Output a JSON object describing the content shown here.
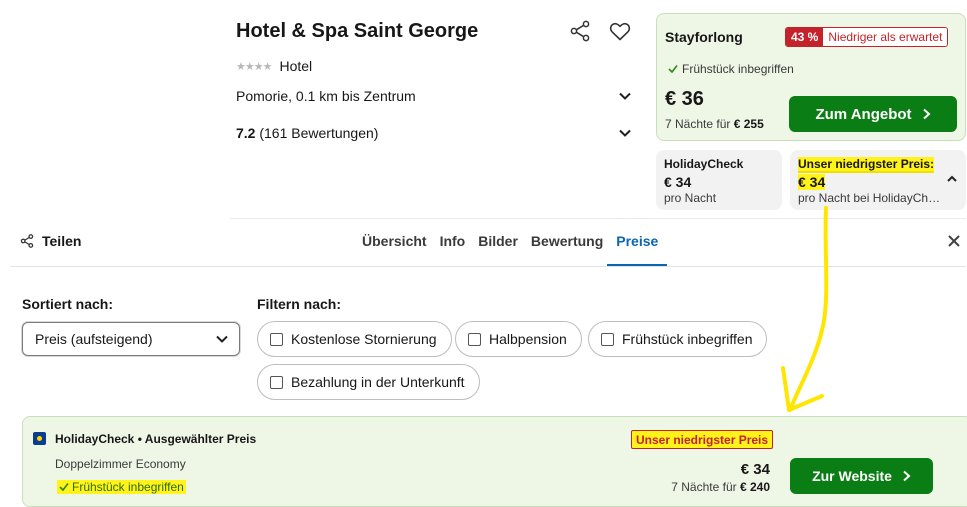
{
  "hotel": {
    "name": "Hotel & Spa Saint George",
    "stars_glyph": "★★★★",
    "category": "Hotel",
    "location": "Pomorie, 0.1 km bis Zentrum",
    "rating_score": "7.2",
    "rating_count": "(161 Bewertungen)"
  },
  "top_offer": {
    "provider": "Stayforlong",
    "discount_pct": "43 %",
    "discount_text": "Niedriger als erwartet",
    "breakfast": "Frühstück inbegriffen",
    "price": "€ 36",
    "nights_prefix": "7 Nächte für",
    "nights_total": "€ 255",
    "cta_label": "Zum Angebot"
  },
  "compare": {
    "left": {
      "title": "HolidayCheck",
      "price": "€ 34",
      "sub": "pro Nacht"
    },
    "right": {
      "title": "Unser niedrigster Preis:",
      "price": "€ 34",
      "sub": "pro Nacht bei HolidayCh…"
    }
  },
  "tabs": {
    "share_label": "Teilen",
    "items": [
      {
        "label": "Übersicht",
        "active": false
      },
      {
        "label": "Info",
        "active": false
      },
      {
        "label": "Bilder",
        "active": false
      },
      {
        "label": "Bewertung",
        "active": false
      },
      {
        "label": "Preise",
        "active": true
      }
    ]
  },
  "sort": {
    "label": "Sortiert nach:",
    "selected": "Preis (aufsteigend)"
  },
  "filters": {
    "label": "Filtern nach:",
    "options": [
      "Kostenlose Stornierung",
      "Halbpension",
      "Frühstück inbegriffen",
      "Bezahlung in der Unterkunft"
    ]
  },
  "result": {
    "provider": "HolidayCheck • Ausgewählter Preis",
    "room": "Doppelzimmer Economy",
    "breakfast": "Frühstück inbegriffen",
    "badge": "Unser niedrigster Preis",
    "price": "€ 34",
    "nights_prefix": "7 Nächte für",
    "nights_total": "€ 240",
    "cta_label": "Zur Website"
  },
  "colors": {
    "accent_blue": "#0b66b0",
    "cta_green": "#0a7d14",
    "offer_bg": "#eef6e6",
    "discount_red": "#c3222a",
    "highlight_yellow": "#fff31a"
  }
}
